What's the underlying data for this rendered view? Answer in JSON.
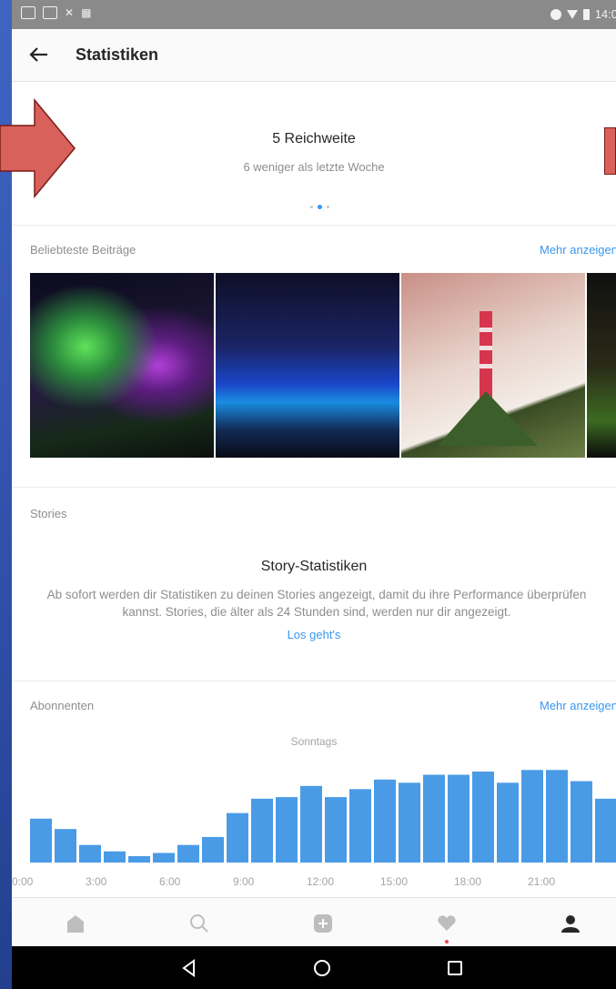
{
  "status_bar": {
    "time": "14:0"
  },
  "header": {
    "title": "Statistiken"
  },
  "reach": {
    "value": "5 Reichweite",
    "subtitle": "6 weniger als letzte Woche"
  },
  "top_posts": {
    "label": "Beliebteste Beiträge",
    "more_link": "Mehr anzeigen"
  },
  "stories": {
    "label": "Stories",
    "title": "Story-Statistiken",
    "text": "Ab sofort werden dir Statistiken zu deinen Stories angezeigt, damit du ihre Performance überprüfen kannst. Stories, die älter als 24 Stunden sind, werden nur dir angezeigt.",
    "link": "Los geht's"
  },
  "followers": {
    "label": "Abonnenten",
    "more_link": "Mehr anzeigen",
    "day": "Sonntags"
  },
  "chart_data": {
    "type": "bar",
    "categories": [
      "0:00",
      "1:00",
      "2:00",
      "3:00",
      "4:00",
      "5:00",
      "6:00",
      "7:00",
      "8:00",
      "9:00",
      "10:00",
      "11:00",
      "12:00",
      "13:00",
      "14:00",
      "15:00",
      "16:00",
      "17:00",
      "18:00",
      "19:00",
      "20:00",
      "21:00",
      "22:00",
      "23:00"
    ],
    "values": [
      55,
      42,
      22,
      14,
      8,
      12,
      22,
      32,
      62,
      80,
      82,
      96,
      82,
      92,
      104,
      100,
      110,
      110,
      114,
      100,
      116,
      116,
      102,
      80
    ],
    "xticks": [
      "0:00",
      "3:00",
      "6:00",
      "9:00",
      "12:00",
      "15:00",
      "18:00",
      "21:00"
    ],
    "bar_color": "#4a9be6",
    "ylim": [
      0,
      130
    ]
  },
  "colors": {
    "accent": "#3897f0",
    "arrow": "#d9615b",
    "active_dot": "#ed4956"
  }
}
